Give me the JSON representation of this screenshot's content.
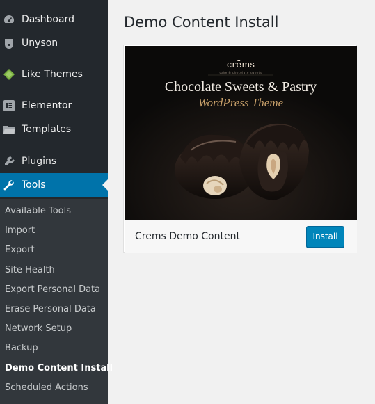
{
  "sidebar": {
    "items": [
      {
        "label": "Dashboard",
        "icon": "dashboard-icon"
      },
      {
        "label": "Unyson",
        "icon": "unyson-icon"
      },
      {
        "label": "Like Themes",
        "icon": "like-themes-icon"
      },
      {
        "label": "Elementor",
        "icon": "elementor-icon"
      },
      {
        "label": "Templates",
        "icon": "folder-icon"
      },
      {
        "label": "Plugins",
        "icon": "plugin-icon"
      },
      {
        "label": "Tools",
        "icon": "wrench-icon",
        "active": true
      }
    ],
    "submenu": [
      "Available Tools",
      "Import",
      "Export",
      "Site Health",
      "Export Personal Data",
      "Erase Personal Data",
      "Network Setup",
      "Backup",
      "Demo Content Install",
      "Scheduled Actions"
    ],
    "current_submenu": "Demo Content Install"
  },
  "main": {
    "title": "Demo Content Install",
    "demo": {
      "thumbnail": {
        "logo": "crēms",
        "tagline": "cake & chocolate sweets",
        "headline": "Chocolate Sweets & Pastry",
        "subheadline": "WordPress Theme"
      },
      "name": "Crems Demo Content",
      "button_label": "Install"
    }
  },
  "colors": {
    "sidebar_bg": "#23282d",
    "submenu_bg": "#32373c",
    "accent": "#0073aa",
    "button": "#0085ba"
  }
}
